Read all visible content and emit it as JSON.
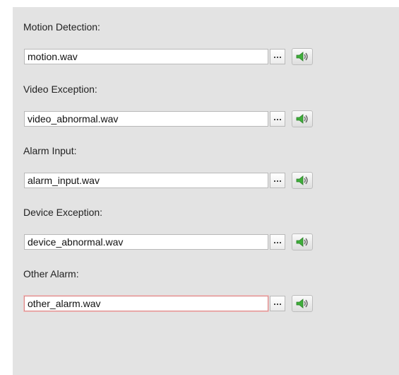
{
  "alarm_sounds": [
    {
      "label": "Motion Detection:",
      "value": "motion.wav"
    },
    {
      "label": "Video Exception:",
      "value": "video_abnormal.wav"
    },
    {
      "label": "Alarm Input:",
      "value": "alarm_input.wav"
    },
    {
      "label": "Device Exception:",
      "value": "device_abnormal.wav"
    },
    {
      "label": "Other Alarm:",
      "value": "other_alarm.wav"
    }
  ],
  "icons": {
    "browse": "ellipsis-icon",
    "play": "speaker-icon"
  },
  "colors": {
    "panel_background": "#e3e3e3",
    "focused_border": "#d98a8a",
    "speaker_green": "#3fae3a"
  }
}
